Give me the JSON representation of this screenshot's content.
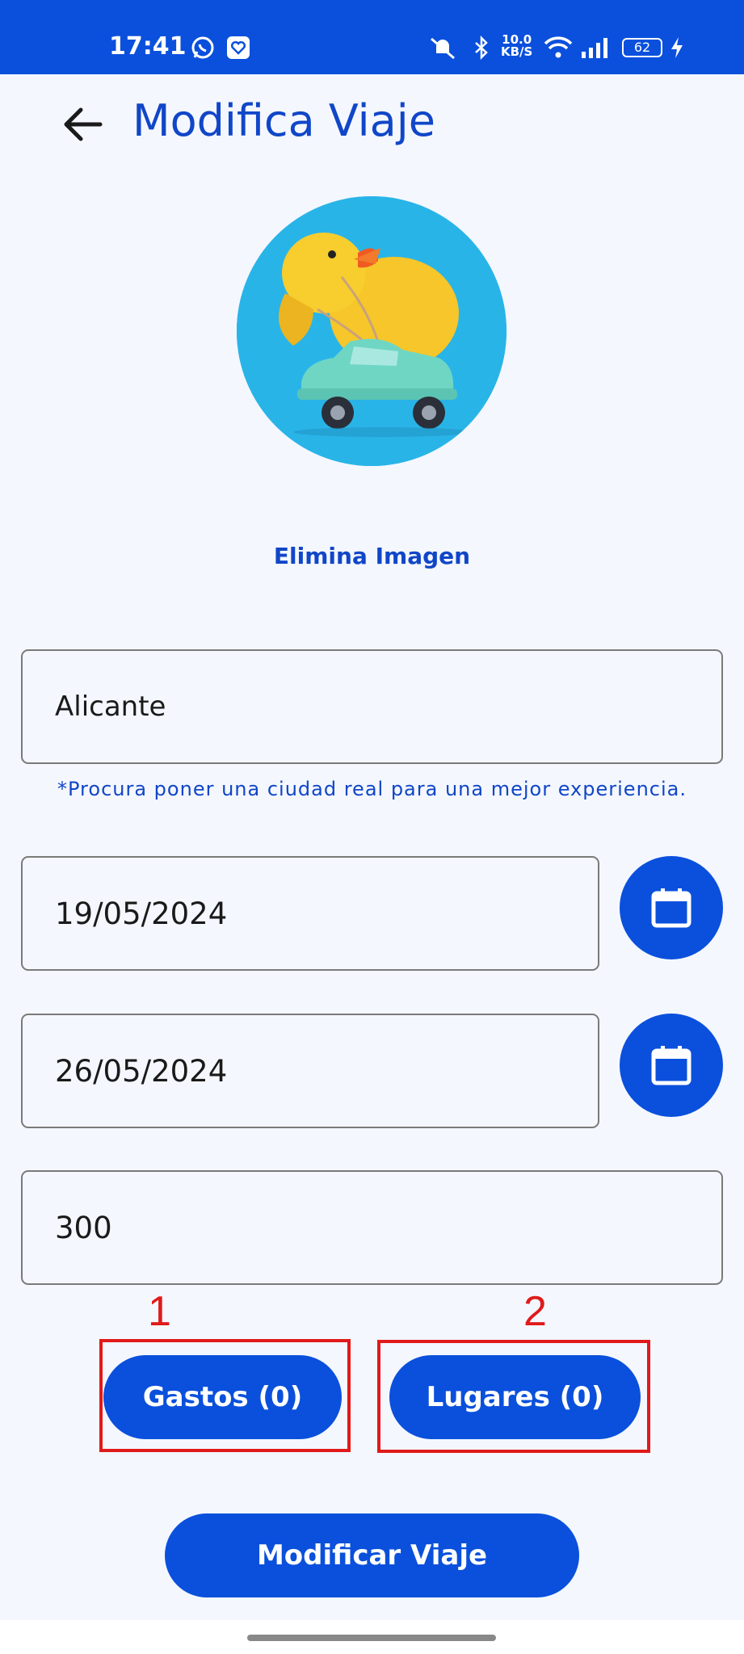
{
  "status_bar": {
    "time": "17:41",
    "net_speed_value": "10.0",
    "net_speed_unit": "KB/S",
    "battery": "62",
    "icons": [
      "whatsapp-icon",
      "app-heart-icon",
      "mute-icon",
      "bluetooth-icon",
      "wifi-icon",
      "signal-icon",
      "battery-icon",
      "charging-icon"
    ]
  },
  "header": {
    "title": "Modifica Viaje",
    "back_icon": "arrow-left-icon"
  },
  "image": {
    "delete_label": "Elimina Imagen"
  },
  "form": {
    "city_value": "Alicante",
    "city_hint": "*Procura poner una ciudad real para una mejor experiencia.",
    "start_date": "19/05/2024",
    "end_date": "26/05/2024",
    "budget": "300"
  },
  "buttons": {
    "expenses": "Gastos (0)",
    "places": "Lugares (0)",
    "submit": "Modificar Viaje"
  },
  "annotations": {
    "one": "1",
    "two": "2"
  },
  "colors": {
    "primary": "#0A50DC",
    "title": "#1046C8",
    "background": "#F4F7FD",
    "annotation": "#E01A1A"
  }
}
